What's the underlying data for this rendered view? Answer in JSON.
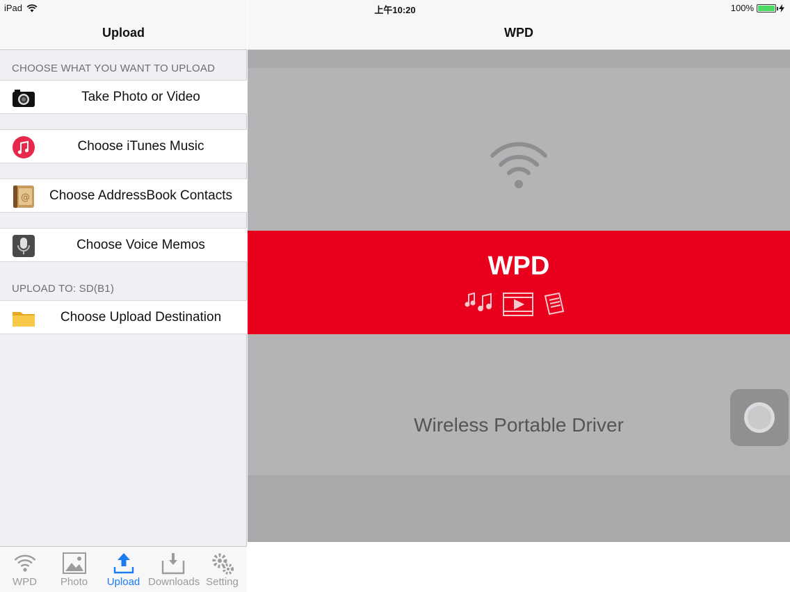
{
  "status_bar": {
    "device": "iPad",
    "time": "上午10:20",
    "battery": "100%"
  },
  "master": {
    "title": "Upload",
    "section_choose": "CHOOSE WHAT YOU WANT TO UPLOAD",
    "items": [
      {
        "label": "Take Photo or Video",
        "icon": "camera-icon"
      },
      {
        "label": "Choose iTunes Music",
        "icon": "itunes-music-icon"
      },
      {
        "label": "Choose AddressBook Contacts",
        "icon": "addressbook-icon"
      },
      {
        "label": "Choose Voice Memos",
        "icon": "voice-memos-icon"
      }
    ],
    "section_upload_to": "UPLOAD TO: SD(B1)",
    "destination_label": "Choose Upload Destination",
    "destination_icon": "folder-icon"
  },
  "tabs": [
    {
      "label": "WPD",
      "icon": "wifi-icon",
      "active": false
    },
    {
      "label": "Photo",
      "icon": "photo-icon",
      "active": false
    },
    {
      "label": "Upload",
      "icon": "upload-icon",
      "active": true
    },
    {
      "label": "Downloads",
      "icon": "downloads-icon",
      "active": false
    },
    {
      "label": "Setting",
      "icon": "gear-icon",
      "active": false
    }
  ],
  "detail": {
    "title": "WPD",
    "brand": "WPD",
    "tagline": "Wireless Portable Driver"
  },
  "colors": {
    "accent": "#1a7cf2",
    "brand_red": "#e8001d",
    "panel_gray": "#b4b4b7"
  }
}
